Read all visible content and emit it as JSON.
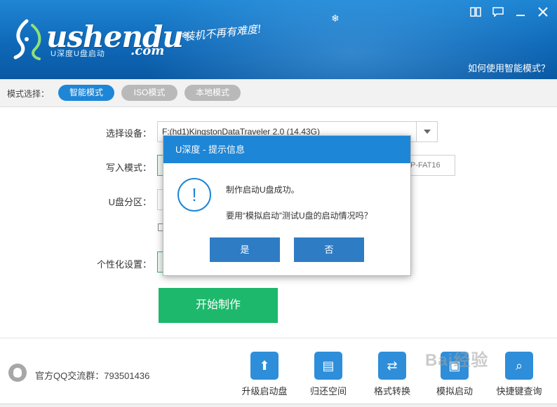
{
  "header": {
    "logo_text": "ushendu",
    "logo_sub": "U深度U盘启动",
    "logo_com": ".com",
    "slogan": "装机不再有难度!",
    "help_link": "如何使用智能模式？",
    "window_buttons": [
      "menu-icon",
      "feedback-icon",
      "minimize-icon",
      "close-icon"
    ]
  },
  "modebar": {
    "label": "模式选择：",
    "modes": [
      "智能模式",
      "ISO模式",
      "本地模式"
    ],
    "active": "智能模式"
  },
  "form": {
    "device_label": "选择设备：",
    "device_value": "F:(hd1)KingstonDataTraveler 2.0 (14.43G)",
    "write_mode_label": "写入模式：",
    "fat_text": "P-FAT16",
    "partition_label": "U盘分区：",
    "personalize_label": "个性化设置：",
    "start_button": "开始制作"
  },
  "footer": {
    "qq_text": "官方QQ交流群：793501436",
    "tools": [
      "升级启动盘",
      "归还空间",
      "格式转换",
      "模拟启动",
      "快捷键查询"
    ]
  },
  "watermark": "Bai经验",
  "dialog": {
    "title": "U深度 - 提示信息",
    "icon": "!",
    "message_line1": "制作启动U盘成功。",
    "message_line2": "要用“模拟启动”测试U盘的启动情况吗？",
    "yes_button": "是",
    "no_button": "否"
  },
  "colors": {
    "accent": "#1e86d6",
    "start_green": "#1db86b",
    "dialog_button": "#2e7cc4"
  }
}
